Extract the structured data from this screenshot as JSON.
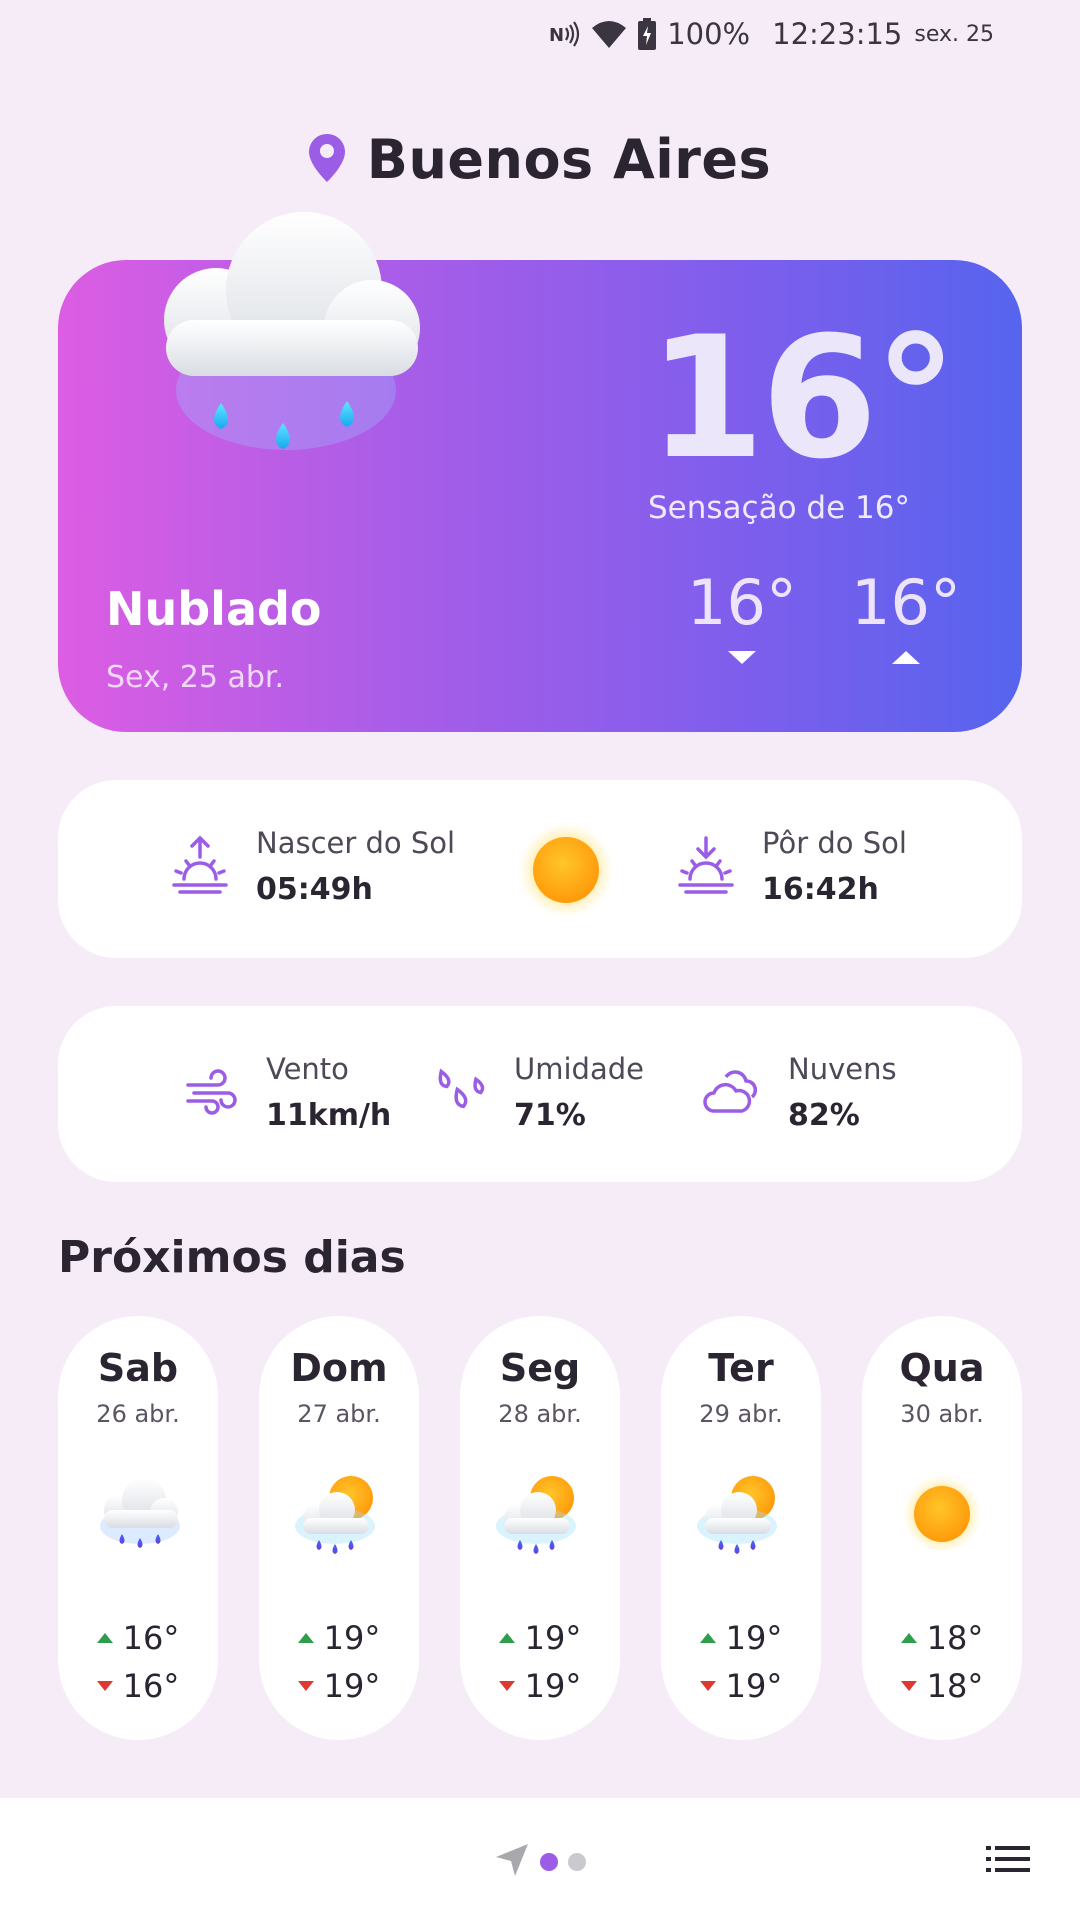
{
  "status_bar": {
    "battery": "100%",
    "time": "12:23:15",
    "date": "sex. 25",
    "icons": [
      "nfc-icon",
      "wifi-icon",
      "battery-charging-icon"
    ]
  },
  "location": {
    "city": "Buenos Aires",
    "icon": "location-pin-icon"
  },
  "current": {
    "temperature": "16°",
    "feels_like": "Sensação de 16°",
    "condition": "Nublado",
    "date": "Sex, 25 abr.",
    "min": "16°",
    "max": "16°",
    "icon": "rain-cloud-icon"
  },
  "sun": {
    "sunrise_label": "Nascer do Sol",
    "sunrise_value": "05:49h",
    "sunset_label": "Pôr do Sol",
    "sunset_value": "16:42h"
  },
  "stats": {
    "wind_label": "Vento",
    "wind_value": "11km/h",
    "humidity_label": "Umidade",
    "humidity_value": "71%",
    "clouds_label": "Nuvens",
    "clouds_value": "82%"
  },
  "forecast_title": "Próximos dias",
  "forecast": [
    {
      "day": "Sab",
      "date": "26 abr.",
      "max": "16°",
      "min": "16°",
      "icon": "rain-cloud-icon"
    },
    {
      "day": "Dom",
      "date": "27 abr.",
      "max": "19°",
      "min": "19°",
      "icon": "sun-cloud-rain-icon"
    },
    {
      "day": "Seg",
      "date": "28 abr.",
      "max": "19°",
      "min": "19°",
      "icon": "sun-cloud-rain-icon"
    },
    {
      "day": "Ter",
      "date": "29 abr.",
      "max": "19°",
      "min": "19°",
      "icon": "sun-cloud-rain-icon"
    },
    {
      "day": "Qua",
      "date": "30 abr.",
      "max": "18°",
      "min": "18°",
      "icon": "sun-icon"
    }
  ],
  "colors": {
    "accent": "#9b5de5",
    "background": "#f6ecf8",
    "hero_gradient_start": "#dc5de3",
    "hero_gradient_end": "#5664ee",
    "up_arrow": "#2e9e4c",
    "down_arrow": "#e0382e"
  }
}
